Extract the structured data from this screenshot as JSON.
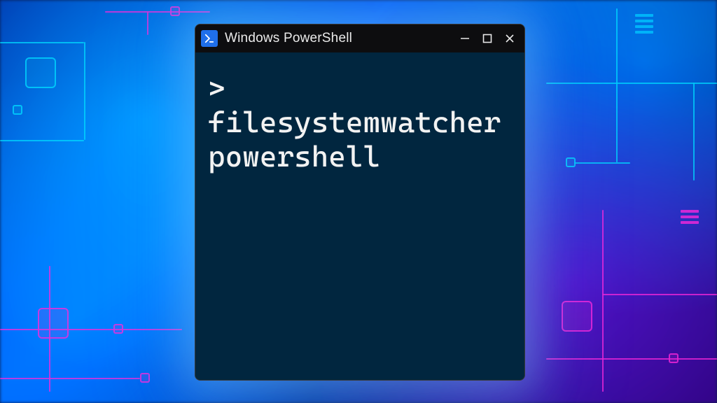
{
  "window": {
    "title": "Windows PowerShell",
    "icon": "powershell-icon"
  },
  "controls": {
    "minimize": "minimize",
    "maximize": "maximize",
    "close": "close"
  },
  "terminal": {
    "prompt": ">",
    "command": "filesystemwatcher powershell"
  },
  "colors": {
    "titlebar_bg": "#0d0d0f",
    "terminal_bg": "#01263f",
    "text": "#f2f2f2",
    "ps_blue": "#1f6feb"
  }
}
